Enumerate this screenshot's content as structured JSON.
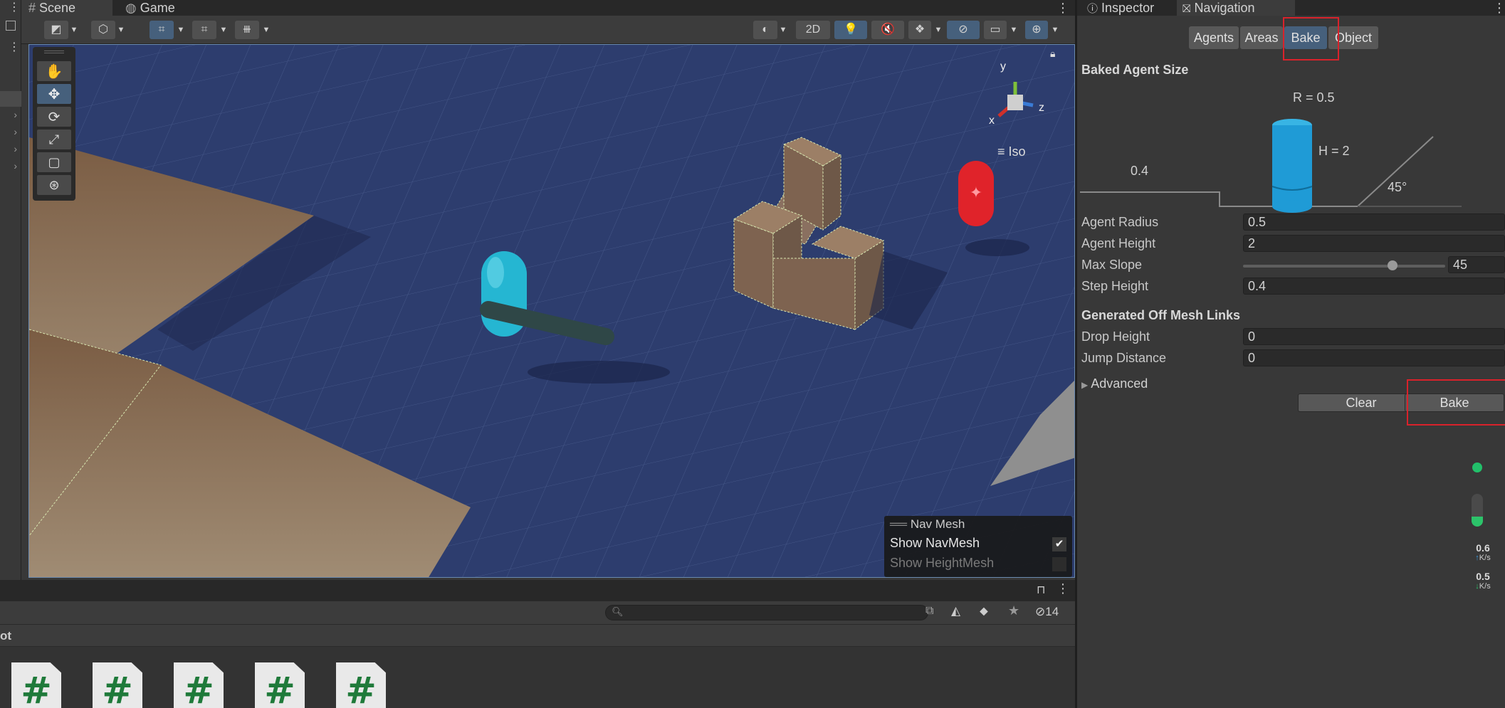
{
  "scene_tabs": {
    "scene": "Scene",
    "game": "Game"
  },
  "toolbar": {
    "mode_2d": "2D"
  },
  "viewport": {
    "gizmo": {
      "y": "y",
      "x": "x",
      "z": "z"
    },
    "projection": "Iso"
  },
  "nav_overlay": {
    "title": "Nav Mesh",
    "show_navmesh": "Show NavMesh",
    "show_heightmesh": "Show HeightMesh",
    "show_navmesh_checked": true,
    "show_heightmesh_checked": false
  },
  "bottom": {
    "path_label": "ot",
    "hidden_count": "14",
    "search_placeholder": "",
    "assets": [
      "#",
      "#",
      "#",
      "#",
      "#"
    ]
  },
  "right_tabs": {
    "inspector": "Inspector",
    "navigation": "Navigation"
  },
  "nav_tabs": {
    "agents": "Agents",
    "areas": "Areas",
    "bake": "Bake",
    "object": "Object"
  },
  "baked_agent_size": {
    "title": "Baked Agent Size",
    "r_label": "R = 0.5",
    "h_label": "H = 2",
    "step_label": "0.4",
    "slope_label": "45°"
  },
  "fields": {
    "agent_radius": {
      "label": "Agent Radius",
      "value": "0.5"
    },
    "agent_height": {
      "label": "Agent Height",
      "value": "2"
    },
    "max_slope": {
      "label": "Max Slope",
      "value": "45",
      "slider_fraction": 0.74
    },
    "step_height": {
      "label": "Step Height",
      "value": "0.4"
    }
  },
  "off_mesh": {
    "title": "Generated Off Mesh Links",
    "drop_height": {
      "label": "Drop Height",
      "value": "0"
    },
    "jump_distance": {
      "label": "Jump Distance",
      "value": "0"
    }
  },
  "advanced": "Advanced",
  "buttons": {
    "clear": "Clear",
    "bake": "Bake"
  },
  "net_widget": {
    "up_value": "0.6",
    "up_unit": "K/s",
    "down_value": "0.5",
    "down_unit": "K/s"
  },
  "colors": {
    "accent": "#46607c",
    "highlight": "#d9222b",
    "navmesh": "#2d3d6e",
    "ground": "#8a6a4e"
  }
}
